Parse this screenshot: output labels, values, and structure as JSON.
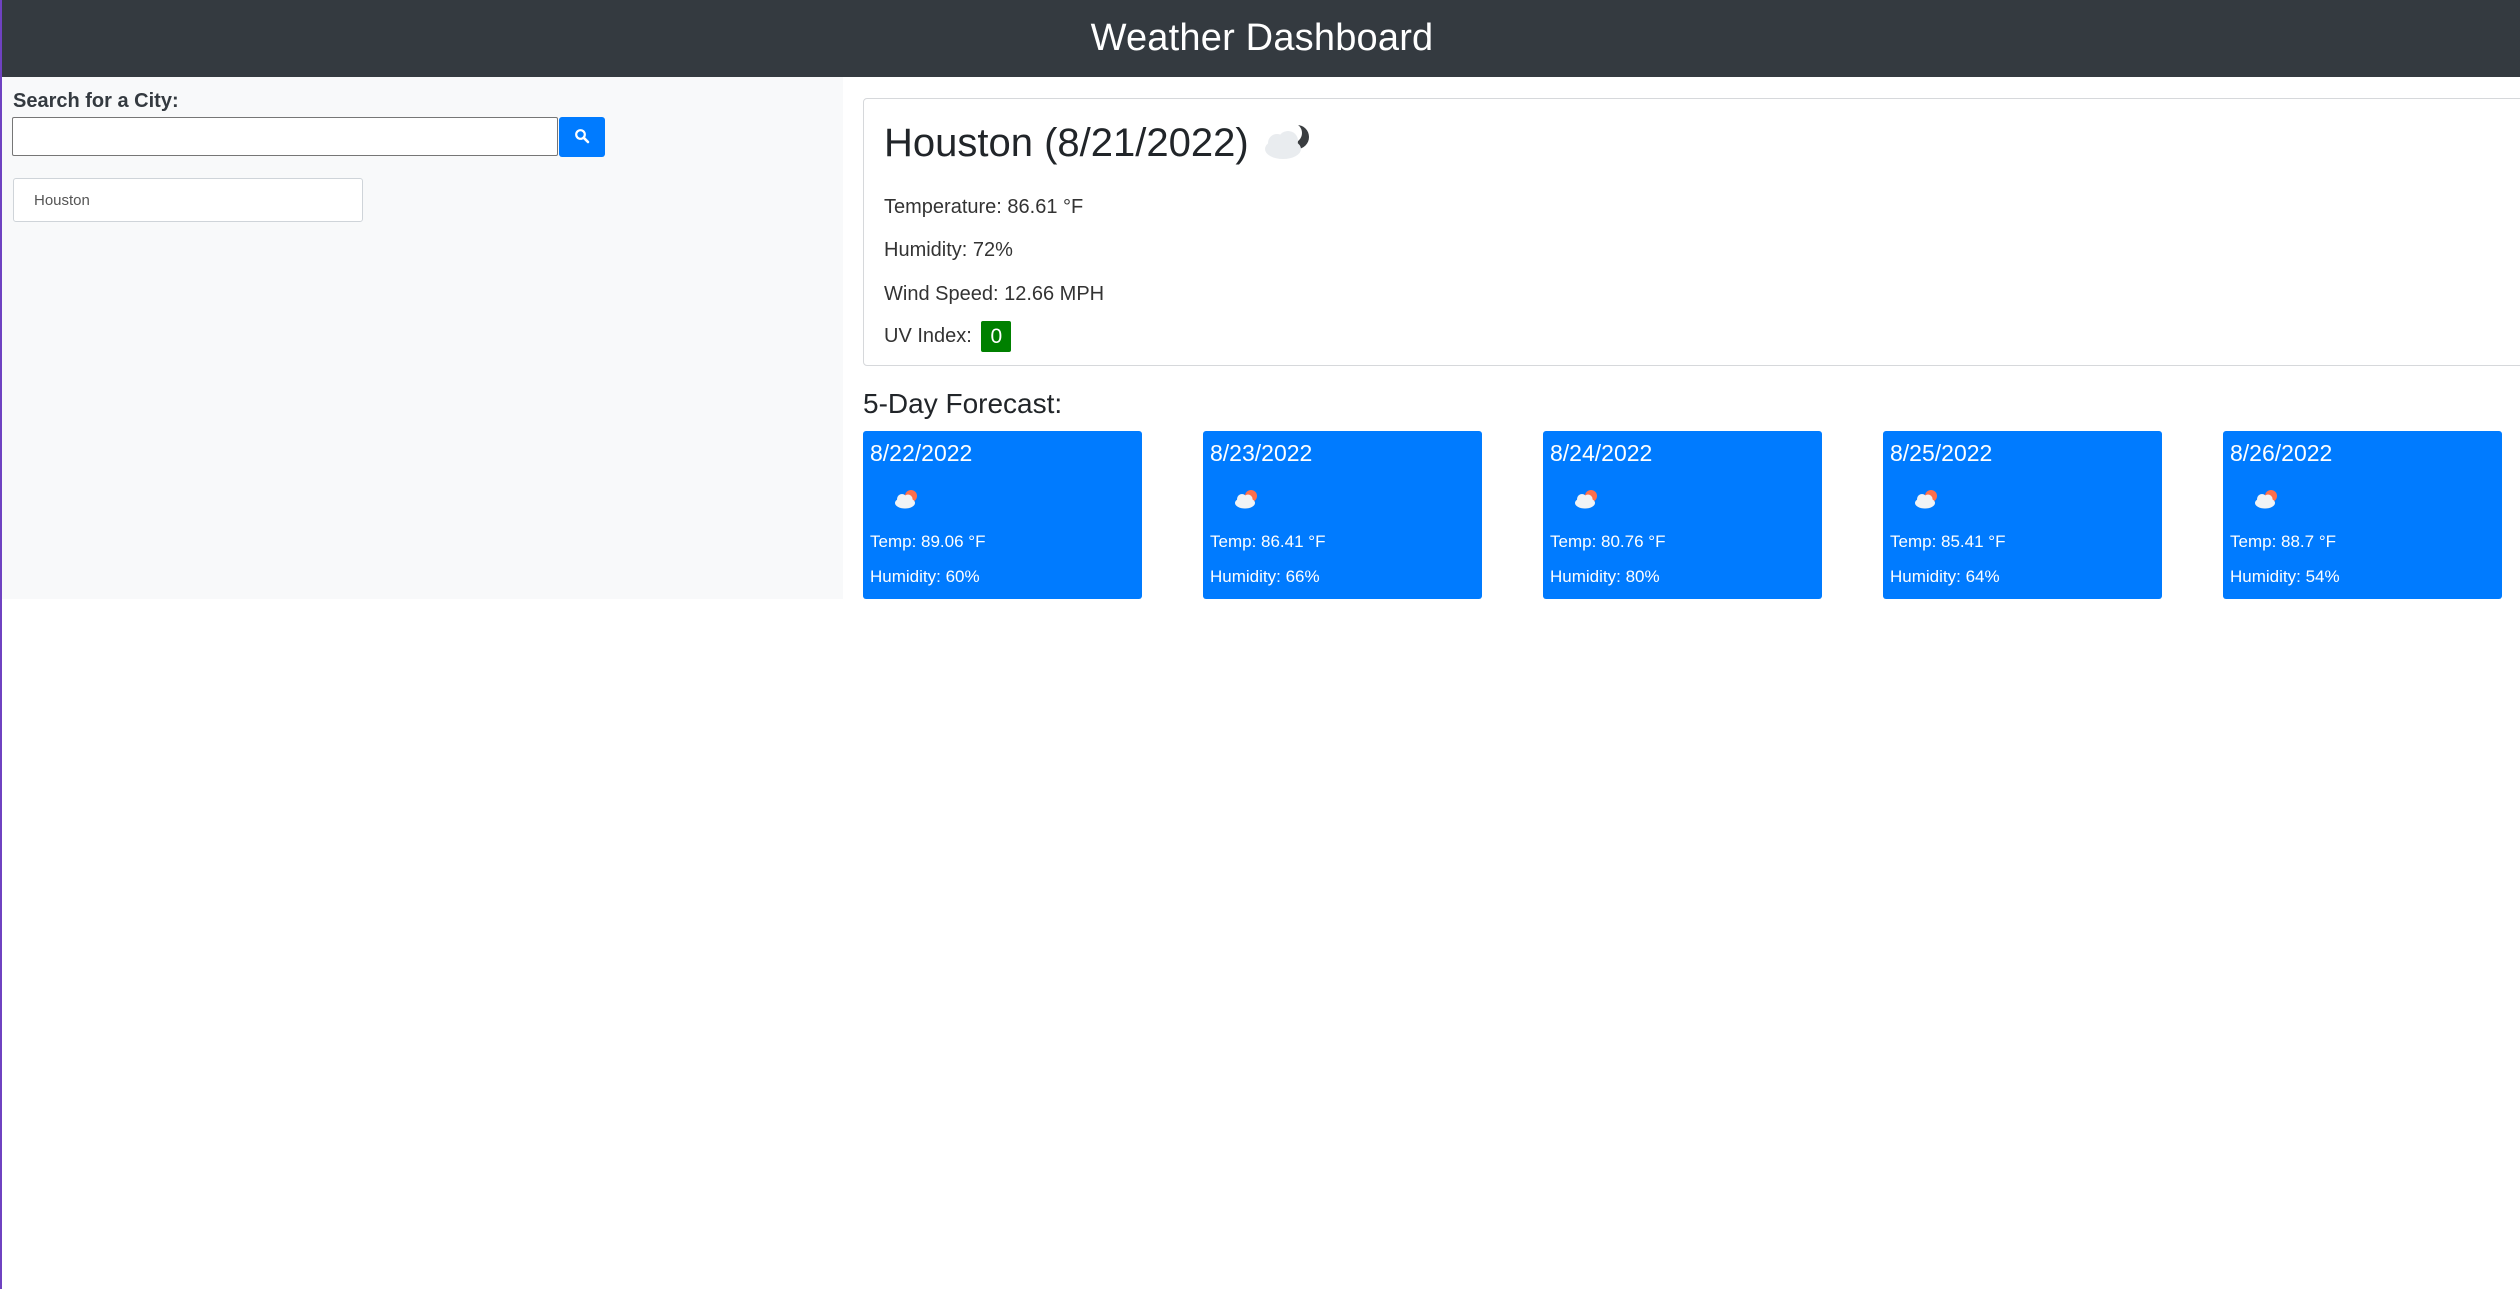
{
  "header": {
    "title": "Weather Dashboard"
  },
  "search": {
    "label": "Search for a City:",
    "value": "",
    "placeholder": "",
    "button_icon": "search-icon"
  },
  "history": [
    "Houston"
  ],
  "current": {
    "title": "Houston (8/21/2022)",
    "icon": "cloudy-night-icon",
    "temperature": "Temperature: 86.61 °F",
    "humidity": "Humidity: 72%",
    "wind": "Wind Speed: 12.66 MPH",
    "uv_label": "UV Index:",
    "uv_value": "0",
    "uv_color": "#008000"
  },
  "forecast": {
    "heading": "5-Day Forecast:",
    "card_color": "#007bff",
    "days": [
      {
        "date": "8/22/2022",
        "icon": "partly-cloudy-day-icon",
        "temp": "Temp: 89.06 °F",
        "humidity": "Humidity: 60%"
      },
      {
        "date": "8/23/2022",
        "icon": "partly-cloudy-day-icon",
        "temp": "Temp: 86.41 °F",
        "humidity": "Humidity: 66%"
      },
      {
        "date": "8/24/2022",
        "icon": "partly-cloudy-day-icon",
        "temp": "Temp: 80.76 °F",
        "humidity": "Humidity: 80%"
      },
      {
        "date": "8/25/2022",
        "icon": "partly-cloudy-day-icon",
        "temp": "Temp: 85.41 °F",
        "humidity": "Humidity: 64%"
      },
      {
        "date": "8/26/2022",
        "icon": "partly-cloudy-day-icon",
        "temp": "Temp: 88.7 °F",
        "humidity": "Humidity: 54%"
      }
    ]
  }
}
